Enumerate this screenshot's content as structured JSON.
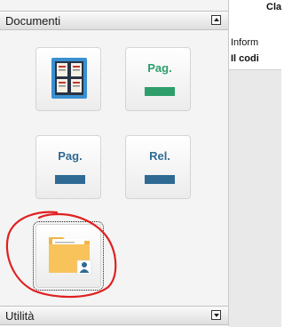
{
  "sections": {
    "documenti": {
      "title": "Documenti"
    },
    "utilita": {
      "title": "Utilità"
    }
  },
  "tiles": [
    {
      "icon": "grid-document-icon",
      "label": ""
    },
    {
      "icon": "page-green-icon",
      "label": "Pag.",
      "color": "#2e9e6a"
    },
    {
      "icon": "page-blue-icon",
      "label": "Pag.",
      "color": "#2f6a94"
    },
    {
      "icon": "report-blue-icon",
      "label": "Rel.",
      "color": "#2f6a94"
    },
    {
      "icon": "folder-user-icon",
      "label": ""
    }
  ],
  "right_panel": {
    "line1": "Cla",
    "line2": "Inform",
    "line3": "Il codi"
  },
  "annotation": {
    "color": "#e02020"
  }
}
